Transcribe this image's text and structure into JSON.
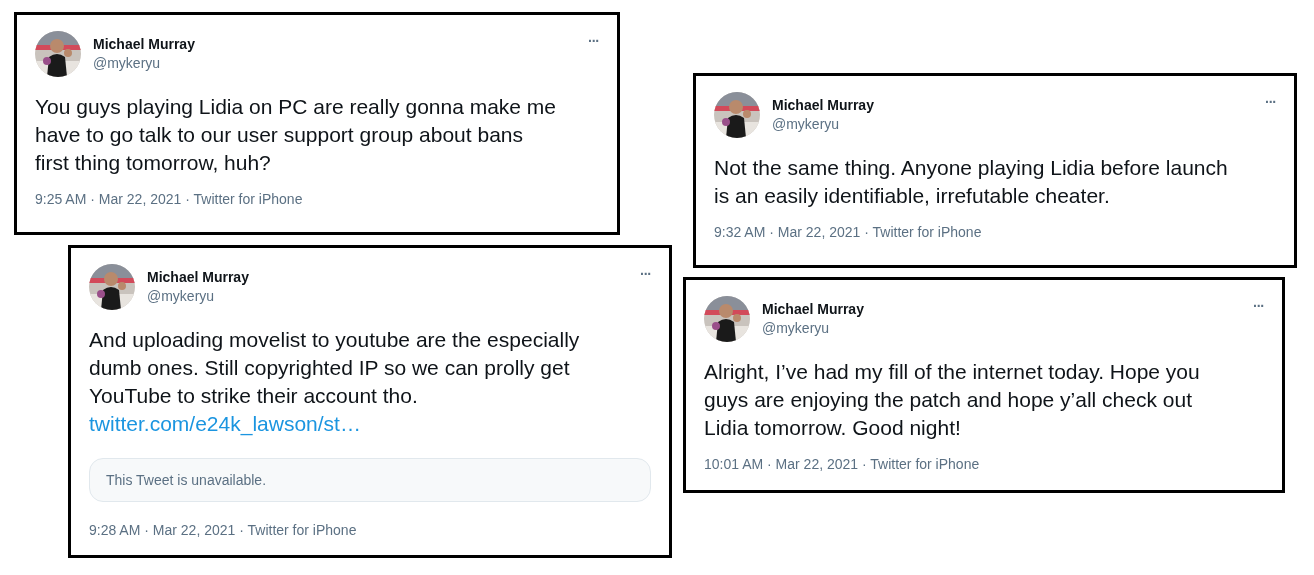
{
  "tweets": [
    {
      "name": "Michael Murray",
      "handle": "@mykeryu",
      "more": "···",
      "text_lines": [
        "You guys playing Lidia on PC are really gonna make me",
        "have to go talk to our user support group about bans",
        "first thing tomorrow, huh?"
      ],
      "meta": "9:25 AM · Mar 22, 2021 · Twitter for iPhone"
    },
    {
      "name": "Michael Murray",
      "handle": "@mykeryu",
      "more": "···",
      "text_lines": [
        "And uploading movelist to youtube are the especially",
        "dumb ones. Still copyrighted IP so we can prolly get",
        "YouTube to strike their account tho."
      ],
      "link": "twitter.com/e24k_lawson/st…",
      "quote": "This Tweet is unavailable.",
      "meta": "9:28 AM · Mar 22, 2021 · Twitter for iPhone"
    },
    {
      "name": "Michael Murray",
      "handle": "@mykeryu",
      "more": "···",
      "text_lines": [
        "Not the same thing. Anyone playing Lidia before launch",
        "is an easily identifiable, irrefutable cheater."
      ],
      "meta": "9:32 AM · Mar 22, 2021 · Twitter for iPhone"
    },
    {
      "name": "Michael Murray",
      "handle": "@mykeryu",
      "more": "···",
      "text_lines": [
        "Alright, I’ve had my fill of the internet today. Hope you",
        "guys are enjoying the patch and hope y’all check out",
        "Lidia tomorrow. Good night!"
      ],
      "meta": "10:01 AM · Mar 22, 2021 · Twitter for iPhone"
    }
  ]
}
